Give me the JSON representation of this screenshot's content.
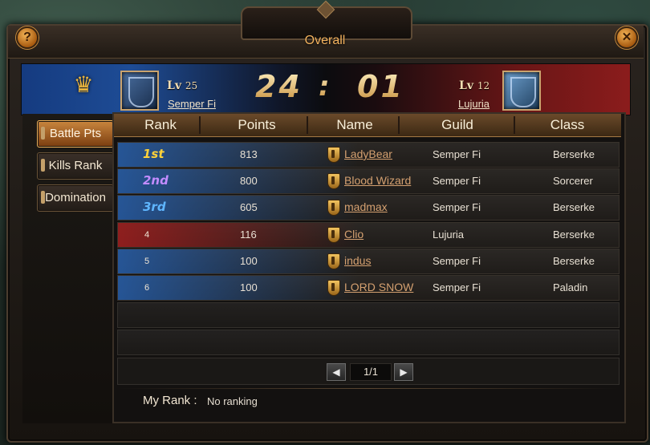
{
  "window": {
    "title": "Overall",
    "help_icon": "?",
    "close_icon": "✕"
  },
  "banner": {
    "left_team": {
      "level_prefix": "Lv",
      "level": "25",
      "name": "Semper Fi",
      "emblem_color": "#2f5a9a"
    },
    "right_team": {
      "level_prefix": "Lv",
      "level": "12",
      "name": "Lujuria",
      "emblem_color": "#4f87bf"
    },
    "score_left": "24",
    "score_separator": ":",
    "score_right": "01",
    "crown_icon": "♛"
  },
  "tabs": [
    {
      "label": "Battle Pts",
      "active": true
    },
    {
      "label": "Kills Rank",
      "active": false
    },
    {
      "label": "Domination",
      "active": false
    }
  ],
  "table": {
    "headers": [
      "Rank",
      "Points",
      "Name",
      "Guild",
      "Class"
    ],
    "rows": [
      {
        "rank": "1st",
        "points": "813",
        "name": "LadyBear",
        "guild": "Semper Fi",
        "class": "Berserke"
      },
      {
        "rank": "2nd",
        "points": "800",
        "name": "Blood Wizard",
        "guild": "Semper Fi",
        "class": "Sorcerer"
      },
      {
        "rank": "3rd",
        "points": "605",
        "name": "madmax",
        "guild": "Semper Fi",
        "class": "Berserke"
      },
      {
        "rank": "4",
        "points": "116",
        "name": "Clio",
        "guild": "Lujuria",
        "class": "Berserke"
      },
      {
        "rank": "5",
        "points": "100",
        "name": "indus",
        "guild": "Semper Fi",
        "class": "Berserke"
      },
      {
        "rank": "6",
        "points": "100",
        "name": "LORD SNOW",
        "guild": "Semper Fi",
        "class": "Paladin"
      }
    ]
  },
  "pager": {
    "prev_icon": "◀",
    "next_icon": "▶",
    "page": "1/1"
  },
  "my_rank": {
    "label": "My Rank :",
    "value": "No ranking"
  },
  "colors": {
    "accent_gold": "#f2b25e",
    "rank_1": "#ffd23a",
    "rank_2": "#c28cff",
    "rank_3": "#5fb6ff",
    "blue_team": "#265eaa",
    "red_team": "#a01e1e"
  }
}
